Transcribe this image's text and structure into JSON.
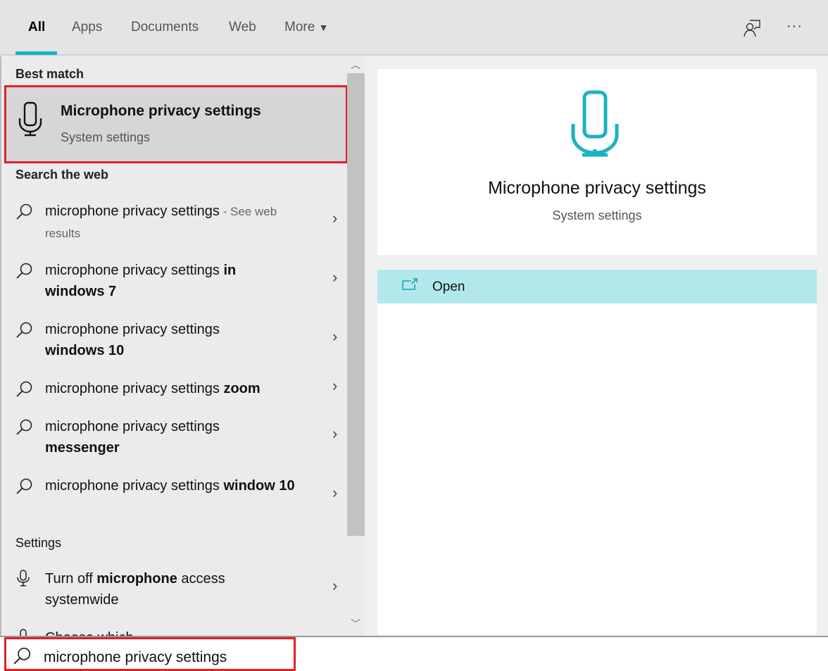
{
  "tabs": [
    {
      "label": "All",
      "active": true
    },
    {
      "label": "Apps"
    },
    {
      "label": "Documents"
    },
    {
      "label": "Web"
    },
    {
      "label": "More"
    }
  ],
  "accent": "#1ab3c3",
  "top_icons": [
    "feedback-person-icon",
    "more-ellipsis-icon"
  ],
  "more_dots": "···",
  "best_match": {
    "header": "Best match",
    "title": "Microphone privacy settings",
    "subtitle": "System settings",
    "icon": "microphone-icon"
  },
  "web": {
    "header": "Search the web",
    "items": [
      {
        "normal": "microphone privacy settings",
        "bold": "",
        "suffix": " - See web results"
      },
      {
        "normal": "microphone privacy settings ",
        "bold": "in windows 7",
        "suffix": ""
      },
      {
        "normal": "microphone privacy settings ",
        "bold": "windows 10",
        "suffix": ""
      },
      {
        "normal": "microphone privacy settings ",
        "bold": "zoom",
        "suffix": ""
      },
      {
        "normal": "microphone privacy settings ",
        "bold": "messenger",
        "suffix": ""
      },
      {
        "normal": "microphone privacy settings ",
        "bold": "window 10",
        "suffix": ""
      }
    ]
  },
  "settings": {
    "header": "Settings",
    "items": [
      {
        "pre": "Turn off ",
        "bold": "microphone",
        "post": " access systemwide"
      },
      {
        "pre": "Choose which",
        "bold": "",
        "post": ""
      }
    ]
  },
  "preview": {
    "title": "Microphone privacy settings",
    "subtitle": "System settings",
    "open_label": "Open"
  },
  "search": {
    "value": "microphone privacy settings"
  },
  "chevron": "›"
}
